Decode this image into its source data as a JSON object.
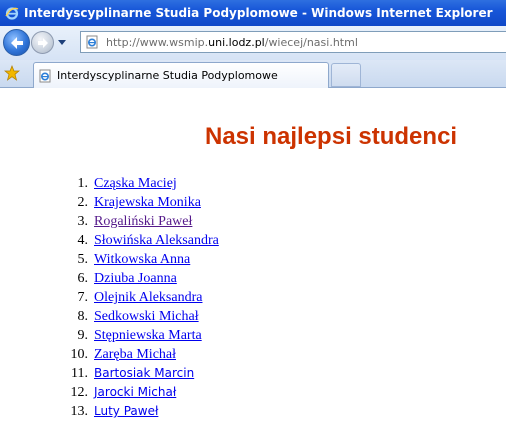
{
  "window": {
    "title": "Interdyscyplinarne Studia Podyplomowe - Windows Internet Explorer"
  },
  "addressbar": {
    "url_prefix": "http://www.wsmip.",
    "url_domain": "uni.lodz.pl",
    "url_path": "/wiecej/nasi.html"
  },
  "tabs": [
    {
      "label": "Interdyscyplinarne Studia Podyplomowe",
      "active": true
    }
  ],
  "page": {
    "heading": "Nasi najlepsi studenci",
    "heading_color": "#cc3300",
    "link_color": "#0000ee",
    "visited_link_color": "#551a8b",
    "students": [
      {
        "num": "1.",
        "name": "Cząska Maciej",
        "visited": false
      },
      {
        "num": "2.",
        "name": "Krajewska Monika",
        "visited": false
      },
      {
        "num": "3.",
        "name": "Rogaliński Paweł",
        "visited": true
      },
      {
        "num": "4.",
        "name": "Słowińska Aleksandra",
        "visited": false
      },
      {
        "num": "5.",
        "name": "Witkowska Anna",
        "visited": false
      },
      {
        "num": "6.",
        "name": "Dziuba Joanna",
        "visited": false
      },
      {
        "num": "7.",
        "name": "Olejnik Aleksandra",
        "visited": false
      },
      {
        "num": "8.",
        "name": "Sedkowski Michał",
        "visited": false
      },
      {
        "num": "9.",
        "name": "Stępniewska Marta",
        "visited": false
      },
      {
        "num": "10.",
        "name": "Zaręba Michał",
        "visited": false
      },
      {
        "num": "11.",
        "name": "Bartosiak Marcin ",
        "visited": false
      },
      {
        "num": "12.",
        "name": "Jarocki Michał",
        "visited": false
      },
      {
        "num": "13.",
        "name": "Luty Paweł",
        "visited": false
      }
    ]
  },
  "icons": {
    "title": "ie-logo-icon",
    "back": "back-arrow-icon",
    "forward": "forward-arrow-icon",
    "dropdown": "chevron-down-icon",
    "page": "ie-page-icon",
    "favorites": "favorites-star-icon",
    "tab": "ie-page-icon"
  }
}
